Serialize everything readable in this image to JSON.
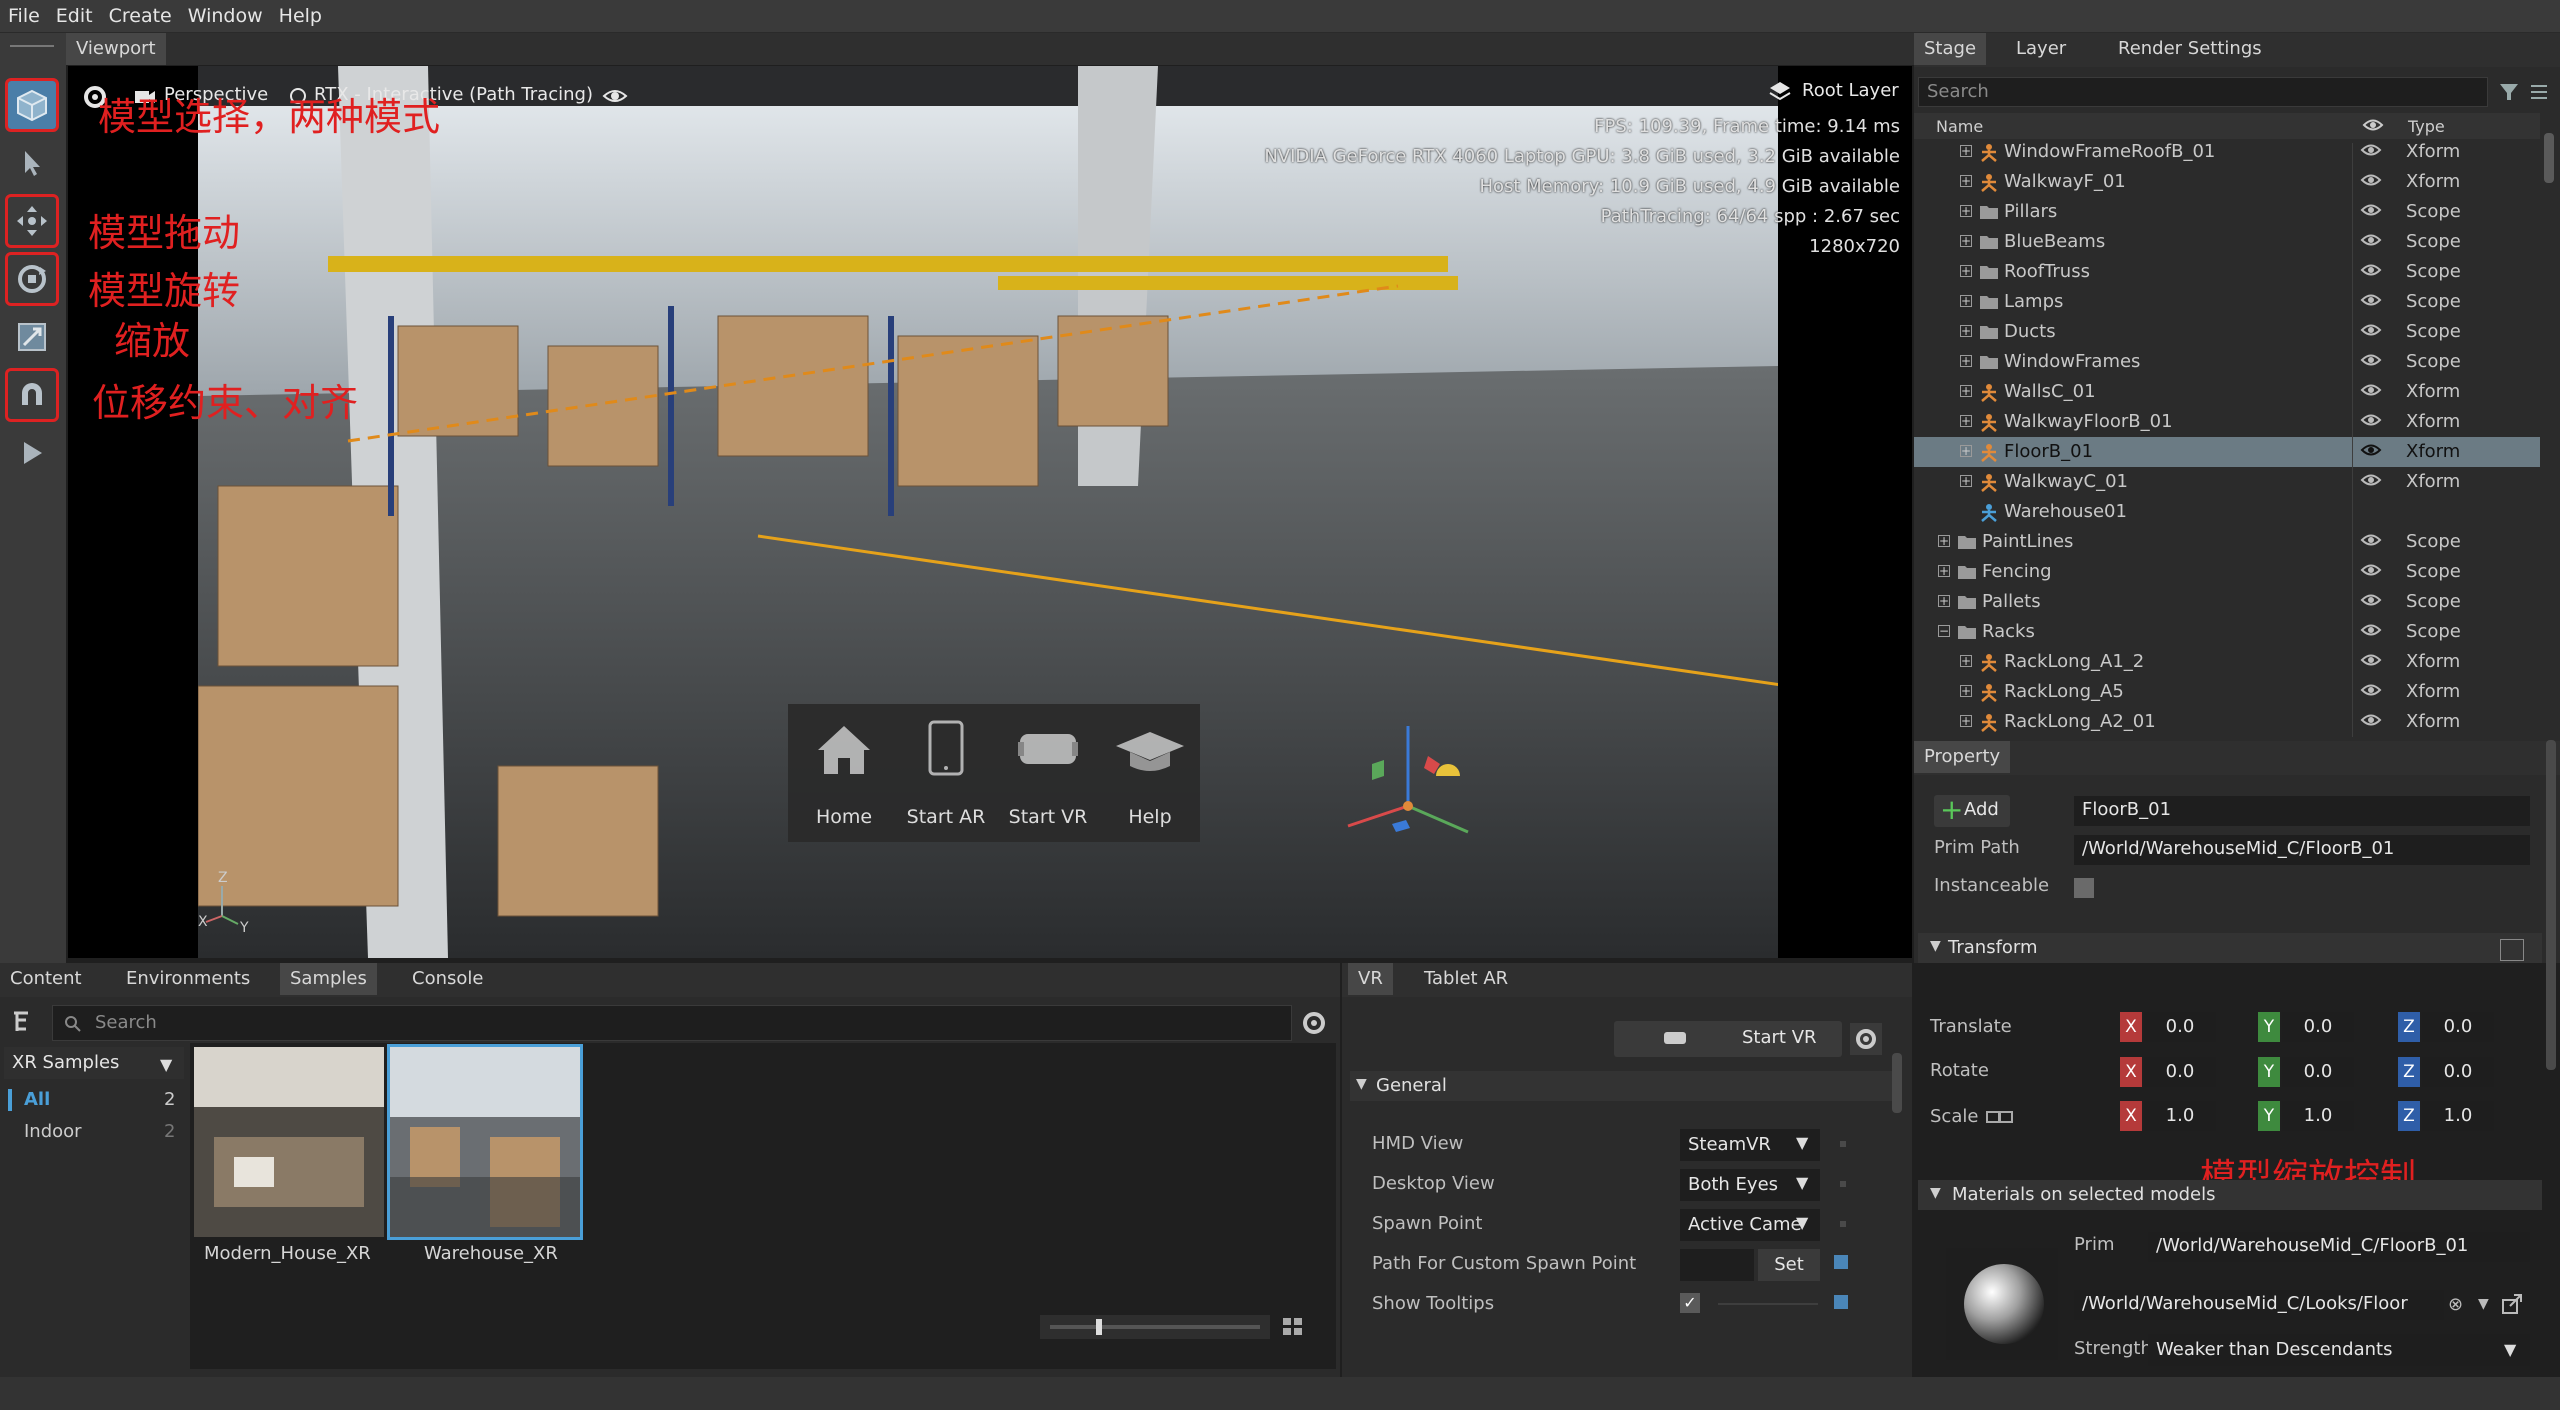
{
  "menu": [
    "File",
    "Edit",
    "Create",
    "Window",
    "Help"
  ],
  "viewport": {
    "tab": "Viewport",
    "camera": "Perspective",
    "renderer": "RTX - Interactive (Path Tracing)",
    "root_layer": "Root Layer",
    "stats": [
      "FPS: 109.39, Frame time: 9.14 ms",
      "NVIDIA GeForce RTX 4060 Laptop GPU: 3.8 GiB used,  3.2 GiB available",
      "Host Memory: 10.9 GiB used, 4.9 GiB available",
      "PathTracing: 64/64 spp : 2.67 sec",
      "1280x720"
    ],
    "annotations": [
      "模型选择，两种模式",
      "模型拖动",
      "模型旋转",
      "缩放",
      "位移约束、对齐"
    ],
    "launcher": [
      "Home",
      "Start AR",
      "Start VR",
      "Help"
    ],
    "gizmo_axes": [
      "Z",
      "X",
      "Y"
    ]
  },
  "stage": {
    "tabs": [
      "Stage",
      "Layer",
      "Render Settings"
    ],
    "search_placeholder": "Search",
    "col_name": "Name",
    "col_type": "Type",
    "rows": [
      {
        "name": "WindowFrameRoofB_01",
        "type": "Xform",
        "icon": "xform",
        "indent": 2
      },
      {
        "name": "WalkwayF_01",
        "type": "Xform",
        "icon": "xform",
        "indent": 2
      },
      {
        "name": "Pillars",
        "type": "Scope",
        "icon": "folder",
        "indent": 2
      },
      {
        "name": "BlueBeams",
        "type": "Scope",
        "icon": "folder",
        "indent": 2
      },
      {
        "name": "RoofTruss",
        "type": "Scope",
        "icon": "folder",
        "indent": 2
      },
      {
        "name": "Lamps",
        "type": "Scope",
        "icon": "folder",
        "indent": 2
      },
      {
        "name": "Ducts",
        "type": "Scope",
        "icon": "folder",
        "indent": 2
      },
      {
        "name": "WindowFrames",
        "type": "Scope",
        "icon": "folder",
        "indent": 2
      },
      {
        "name": "WallsC_01",
        "type": "Xform",
        "icon": "xform",
        "indent": 2
      },
      {
        "name": "WalkwayFloorB_01",
        "type": "Xform",
        "icon": "xform",
        "indent": 2
      },
      {
        "name": "FloorB_01",
        "type": "Xform",
        "icon": "xform",
        "indent": 2,
        "selected": true
      },
      {
        "name": "WalkwayC_01",
        "type": "Xform",
        "icon": "xform",
        "indent": 2
      },
      {
        "name": "Warehouse01",
        "type": "",
        "icon": "xform-plain",
        "indent": 2
      },
      {
        "name": "PaintLines",
        "type": "Scope",
        "icon": "folder",
        "indent": 1
      },
      {
        "name": "Fencing",
        "type": "Scope",
        "icon": "folder",
        "indent": 1
      },
      {
        "name": "Pallets",
        "type": "Scope",
        "icon": "folder",
        "indent": 1
      },
      {
        "name": "Racks",
        "type": "Scope",
        "icon": "folder",
        "indent": 1,
        "open": true
      },
      {
        "name": "RackLong_A1_2",
        "type": "Xform",
        "icon": "xform",
        "indent": 2
      },
      {
        "name": "RackLong_A5",
        "type": "Xform",
        "icon": "xform",
        "indent": 2
      },
      {
        "name": "RackLong_A2_01",
        "type": "Xform",
        "icon": "xform",
        "indent": 2
      }
    ]
  },
  "property": {
    "tab": "Property",
    "add_label": "Add",
    "name_value": "FloorB_01",
    "prim_path_label": "Prim Path",
    "prim_path_value": "/World/WarehouseMid_C/FloorB_01",
    "instanceable_label": "Instanceable",
    "transform_header": "Transform",
    "translate_label": "Translate",
    "rotate_label": "Rotate",
    "scale_label": "Scale",
    "translate": [
      "0.0",
      "0.0",
      "0.0"
    ],
    "rotate": [
      "0.0",
      "0.0",
      "0.0"
    ],
    "scale": [
      "1.0",
      "1.0",
      "1.0"
    ],
    "axis_labels": [
      "X",
      "Y",
      "Z"
    ],
    "annotation": "模型缩放控制",
    "materials_header": "Materials on selected models",
    "mat_prim_label": "Prim",
    "mat_prim_value": "/World/WarehouseMid_C/FloorB_01",
    "mat_path_value": "/World/WarehouseMid_C/Looks/Floor",
    "strength_label": "Strength",
    "strength_value": "Weaker than Descendants"
  },
  "content": {
    "tabs": [
      "Content",
      "Environments",
      "Samples",
      "Console"
    ],
    "active_tab": "Samples",
    "search_placeholder": "Search",
    "collection": "XR Samples",
    "filters": [
      {
        "label": "All",
        "count": "2"
      },
      {
        "label": "Indoor",
        "count": "2"
      }
    ],
    "samples": [
      "Modern_House_XR",
      "Warehouse_XR"
    ]
  },
  "vr": {
    "tabs": [
      "VR",
      "Tablet AR"
    ],
    "start_label": "Start VR",
    "general_header": "General",
    "settings": [
      {
        "label": "HMD View",
        "value": "SteamVR",
        "kind": "dropdown"
      },
      {
        "label": "Desktop View",
        "value": "Both Eyes",
        "kind": "dropdown"
      },
      {
        "label": "Spawn Point",
        "value": "Active Came",
        "kind": "dropdown"
      },
      {
        "label": "Path For Custom Spawn Point",
        "value": "Set",
        "kind": "button"
      },
      {
        "label": "Show Tooltips",
        "value": "",
        "kind": "checkbox"
      }
    ]
  },
  "colors": {
    "accent": "#4a9fd8",
    "selection": "#6b7b84",
    "annotation": "#e02020",
    "axis_x": "#b53a3a",
    "axis_y": "#3e8a3e",
    "axis_z": "#2f5ea8"
  }
}
